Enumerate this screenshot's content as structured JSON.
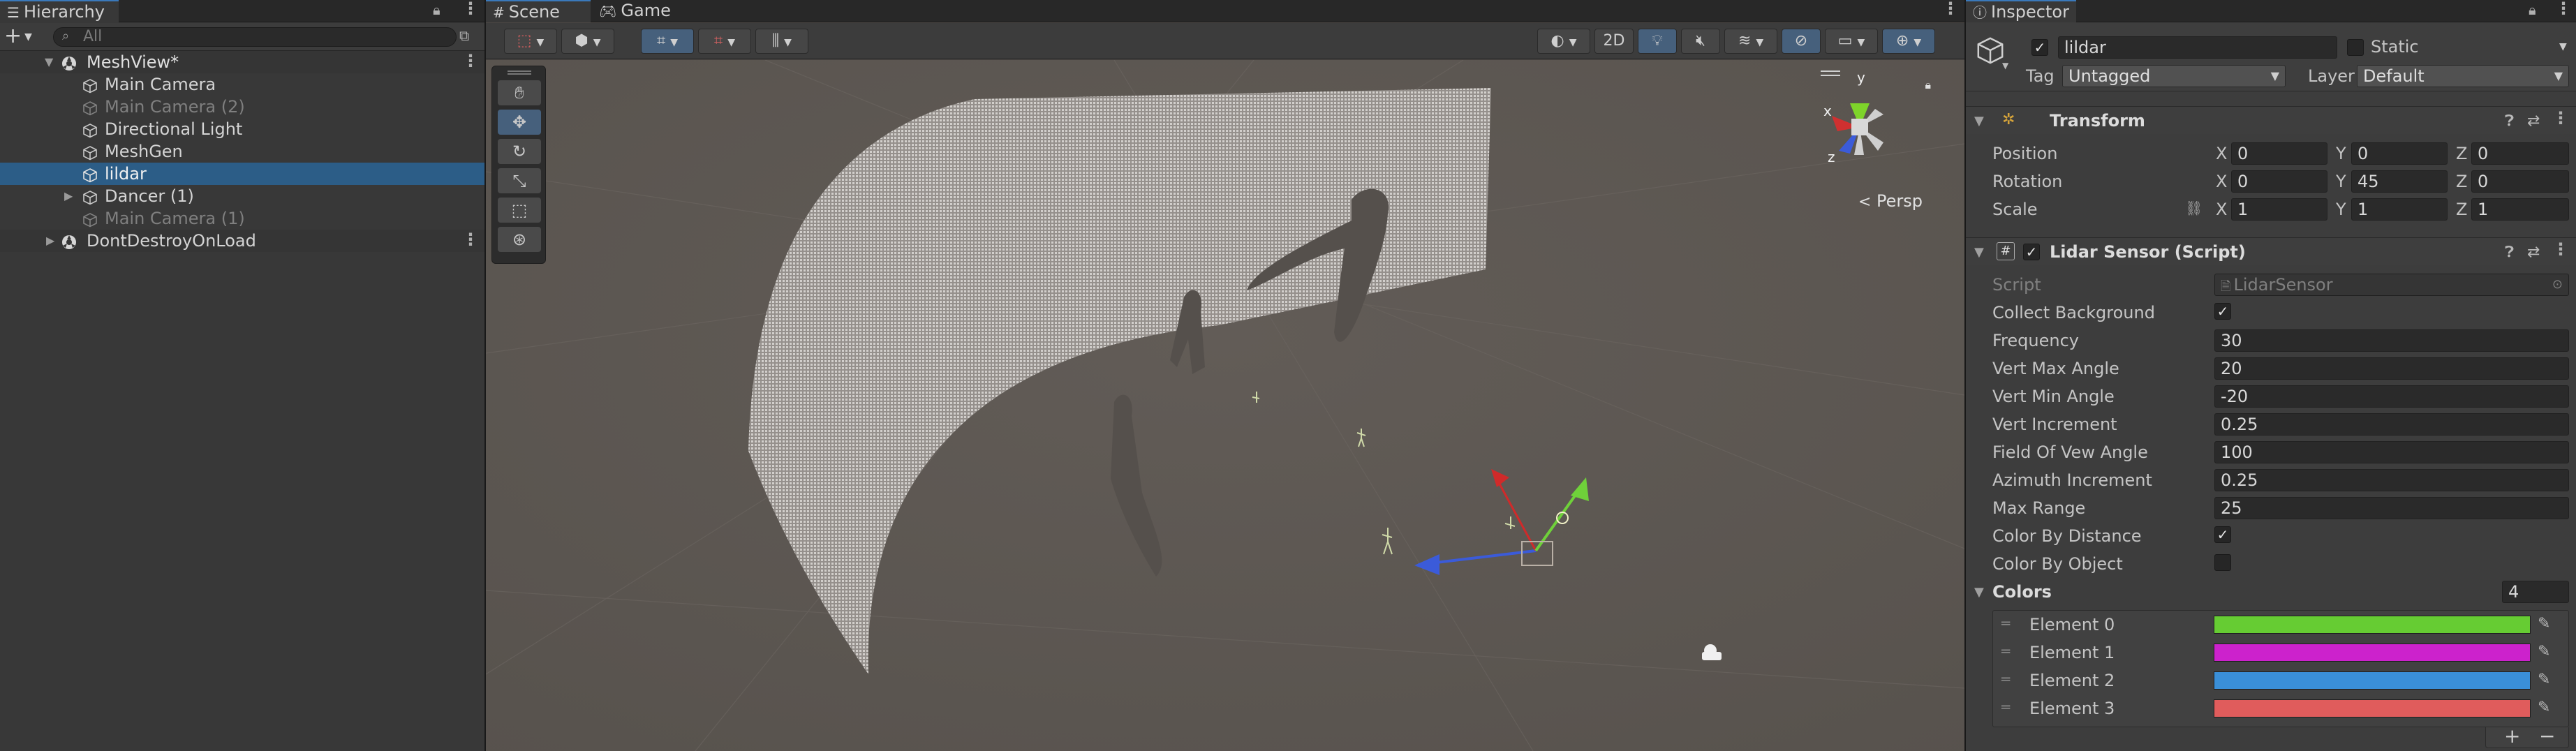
{
  "hierarchy": {
    "tab_label": "Hierarchy",
    "search_placeholder": "All",
    "add_label": "+",
    "items": [
      {
        "label": "MeshView*",
        "depth": 0,
        "kind": "scene",
        "expanded": true
      },
      {
        "label": "Main Camera",
        "depth": 1,
        "kind": "object"
      },
      {
        "label": "Main Camera (2)",
        "depth": 1,
        "kind": "object",
        "inactive": true
      },
      {
        "label": "Directional Light",
        "depth": 1,
        "kind": "object"
      },
      {
        "label": "MeshGen",
        "depth": 1,
        "kind": "object"
      },
      {
        "label": "lildar",
        "depth": 1,
        "kind": "object",
        "selected": true
      },
      {
        "label": "Dancer (1)",
        "depth": 1,
        "kind": "object",
        "collapsed": true
      },
      {
        "label": "Main Camera (1)",
        "depth": 1,
        "kind": "object",
        "inactive": true
      },
      {
        "label": "DontDestroyOnLoad",
        "depth": 0,
        "kind": "scene",
        "collapsed": true
      }
    ]
  },
  "scene": {
    "tabs": [
      {
        "label": "Scene",
        "icon": "grid-icon"
      },
      {
        "label": "Game",
        "icon": "gamepad-icon"
      }
    ],
    "mode_2d": "2D",
    "persp_label": "Persp",
    "gizmo_axes": {
      "x": "x",
      "y": "y",
      "z": "z"
    }
  },
  "inspector": {
    "tab_label": "Inspector",
    "object_name": "lildar",
    "static_label": "Static",
    "tag_label": "Tag",
    "tag_value": "Untagged",
    "layer_label": "Layer",
    "layer_value": "Default",
    "transform": {
      "title": "Transform",
      "position_label": "Position",
      "rotation_label": "Rotation",
      "scale_label": "Scale",
      "position": {
        "x": "0",
        "y": "0",
        "z": "0"
      },
      "rotation": {
        "x": "0",
        "y": "45",
        "z": "0"
      },
      "scale": {
        "x": "1",
        "y": "1",
        "z": "1"
      }
    },
    "lidar": {
      "title": "Lidar Sensor (Script)",
      "script_label": "Script",
      "script_value": "LidarSensor",
      "fields": [
        {
          "label": "Collect Background",
          "type": "bool",
          "value": true
        },
        {
          "label": "Frequency",
          "type": "text",
          "value": "30"
        },
        {
          "label": "Vert Max Angle",
          "type": "text",
          "value": "20"
        },
        {
          "label": "Vert Min Angle",
          "type": "text",
          "value": "-20"
        },
        {
          "label": "Vert Increment",
          "type": "text",
          "value": "0.25"
        },
        {
          "label": "Field Of Vew Angle",
          "type": "text",
          "value": "100"
        },
        {
          "label": "Azimuth Increment",
          "type": "text",
          "value": "0.25"
        },
        {
          "label": "Max Range",
          "type": "text",
          "value": "25"
        },
        {
          "label": "Color By Distance",
          "type": "bool",
          "value": true
        },
        {
          "label": "Color By Object",
          "type": "bool",
          "value": false
        }
      ],
      "colors_label": "Colors",
      "colors_count": "4",
      "elements": [
        {
          "label": "Element 0",
          "color": "#66cc33"
        },
        {
          "label": "Element 1",
          "color": "#cc22cc"
        },
        {
          "label": "Element 2",
          "color": "#3a8fd8"
        },
        {
          "label": "Element 3",
          "color": "#e05c5c"
        }
      ]
    }
  }
}
